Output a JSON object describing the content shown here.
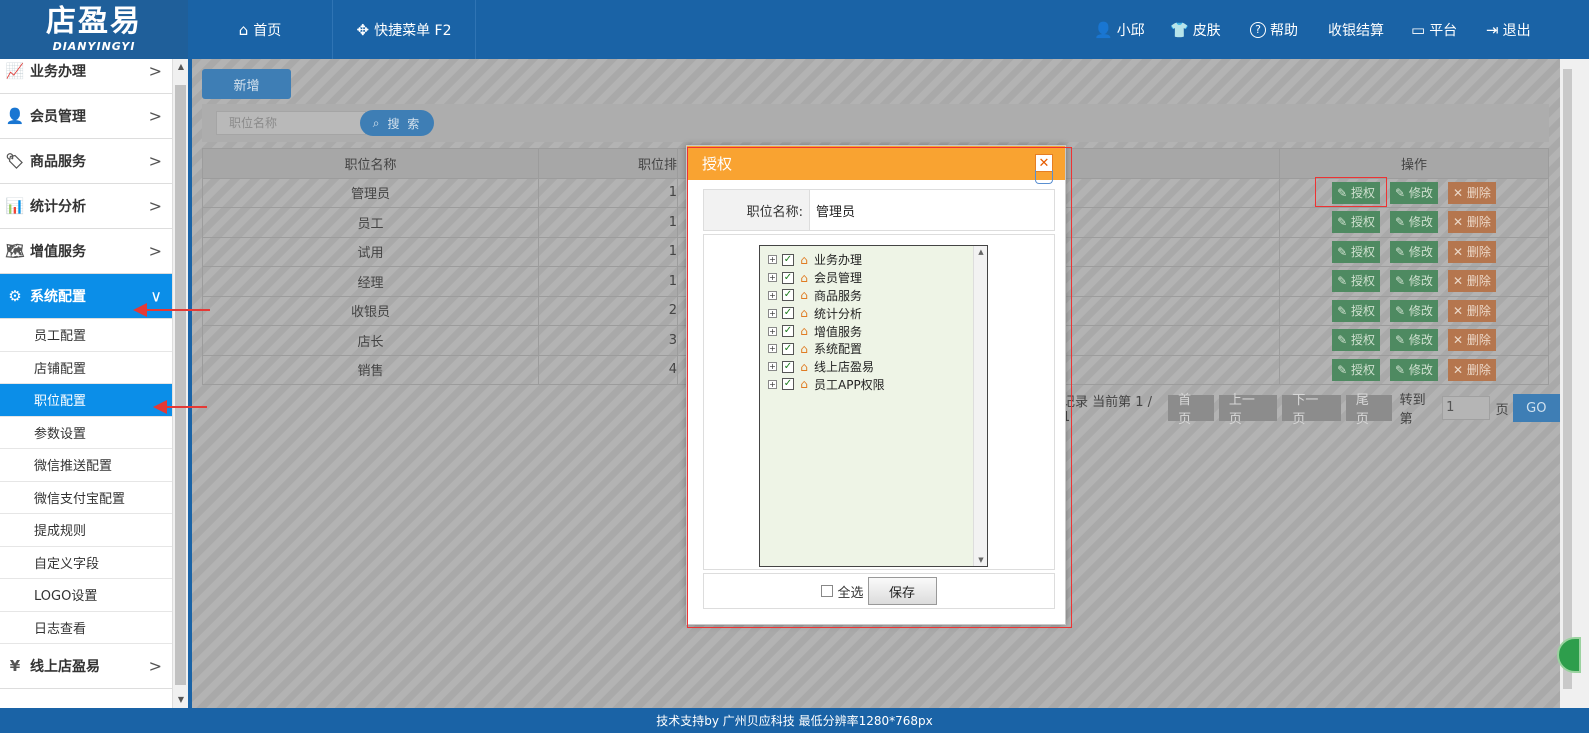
{
  "header": {
    "logo_cn": "店盈易",
    "logo_en": "DIANYINGYI",
    "nav": [
      {
        "label": "首页",
        "icon": "home-icon",
        "glyph": "⌂"
      },
      {
        "label": "快捷菜单 F2",
        "icon": "move-icon",
        "glyph": "✥"
      }
    ],
    "right": [
      {
        "label": "小邱",
        "icon": "user-icon",
        "glyph": "👤"
      },
      {
        "label": "皮肤",
        "icon": "shirt-icon",
        "glyph": "👕"
      },
      {
        "label": "帮助",
        "icon": "help-icon",
        "glyph": "?"
      },
      {
        "label": "收银结算",
        "icon": "",
        "glyph": ""
      },
      {
        "label": "平台",
        "icon": "monitor-icon",
        "glyph": "▭"
      },
      {
        "label": "退出",
        "icon": "logout-icon",
        "glyph": "⇥"
      }
    ]
  },
  "sidebar": {
    "menu": [
      {
        "label": "业务办理",
        "icon": "chart-icon",
        "glyph": "📈"
      },
      {
        "label": "会员管理",
        "icon": "member-icon",
        "glyph": "👤"
      },
      {
        "label": "商品服务",
        "icon": "tag-icon",
        "glyph": "🏷"
      },
      {
        "label": "统计分析",
        "icon": "stats-icon",
        "glyph": "📊"
      },
      {
        "label": "增值服务",
        "icon": "map-icon",
        "glyph": "🗺"
      },
      {
        "label": "系统配置",
        "icon": "gear-icon",
        "glyph": "⚙"
      }
    ],
    "submenu": [
      "员工配置",
      "店铺配置",
      "职位配置",
      "参数设置",
      "微信推送配置",
      "微信支付宝配置",
      "提成规则",
      "自定义字段",
      "LOGO设置",
      "日志查看"
    ],
    "last_menu": {
      "label": "线上店盈易",
      "icon": "shop-icon",
      "glyph": "¥"
    }
  },
  "toolbar": {
    "new_label": "新增",
    "search_placeholder": "职位名称",
    "search_label": "搜 索"
  },
  "table": {
    "headers": [
      "职位名称",
      "职位排",
      "操作"
    ],
    "rows": [
      {
        "name": "管理员",
        "sort": "1"
      },
      {
        "name": "员工",
        "sort": "1"
      },
      {
        "name": "试用",
        "sort": "1"
      },
      {
        "name": "经理",
        "sort": "1"
      },
      {
        "name": "收银员",
        "sort": "2"
      },
      {
        "name": "店长",
        "sort": "3"
      },
      {
        "name": "销售",
        "sort": "4"
      }
    ],
    "actions": {
      "auth": "授权",
      "edit": "修改",
      "delete": "删除"
    }
  },
  "pager": {
    "info": "记录 当前第 1 / 1",
    "first": "首页",
    "prev": "上一页",
    "next": "下一页",
    "last": "尾页",
    "goto_label": "转到第",
    "page_value": "1",
    "page_suffix": "页",
    "go": "GO"
  },
  "modal": {
    "title": "授权",
    "field_label": "职位名称:",
    "field_value": "管理员",
    "tree": [
      "业务办理",
      "会员管理",
      "商品服务",
      "统计分析",
      "增值服务",
      "系统配置",
      "线上店盈易",
      "员工APP权限"
    ],
    "select_all": "全选",
    "save": "保存"
  },
  "footer": {
    "text": "技术支持by 广州贝应科技    最低分辨率1280*768px"
  },
  "colors": {
    "brand": "#1a63a6",
    "active": "#0b8ee8",
    "modal_title": "#f9a331",
    "highlight": "#e53935"
  }
}
